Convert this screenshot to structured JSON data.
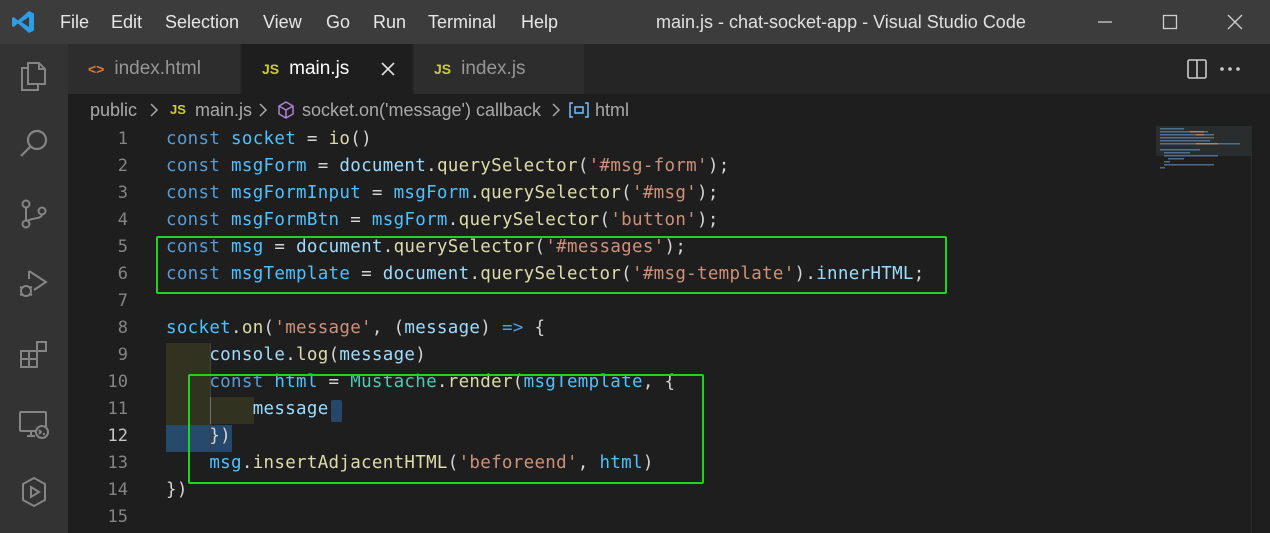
{
  "menu": {
    "items": [
      "File",
      "Edit",
      "Selection",
      "View",
      "Go",
      "Run",
      "Terminal",
      "Help"
    ]
  },
  "window": {
    "title": "main.js - chat-socket-app - Visual Studio Code"
  },
  "activity_bar": {
    "icons": [
      "explorer-icon",
      "search-icon",
      "source-control-icon",
      "run-debug-icon",
      "extensions-icon",
      "remote-explorer-icon",
      "live-share-icon"
    ]
  },
  "tabs": [
    {
      "label": "index.html",
      "badge": "<>",
      "active": false
    },
    {
      "label": "main.js",
      "badge": "JS",
      "active": true
    },
    {
      "label": "index.js",
      "badge": "JS",
      "active": false
    }
  ],
  "breadcrumb": {
    "folder": "public",
    "file_badge": "JS",
    "file": "main.js",
    "callback": "socket.on('message') callback",
    "symbol": "html"
  },
  "editor": {
    "line_numbers": [
      "1",
      "2",
      "3",
      "4",
      "5",
      "6",
      "7",
      "8",
      "9",
      "10",
      "11",
      "12",
      "13",
      "14",
      "15"
    ],
    "current_line": "12",
    "lines": [
      [
        [
          "kw",
          "const"
        ],
        [
          "pun",
          " "
        ],
        [
          "var",
          "socket"
        ],
        [
          "pun",
          " = "
        ],
        [
          "fn",
          "io"
        ],
        [
          "pun",
          "()"
        ]
      ],
      [
        [
          "kw",
          "const"
        ],
        [
          "pun",
          " "
        ],
        [
          "var",
          "msgForm"
        ],
        [
          "pun",
          " = "
        ],
        [
          "id",
          "document"
        ],
        [
          "pun",
          "."
        ],
        [
          "fn",
          "querySelector"
        ],
        [
          "pun",
          "("
        ],
        [
          "str",
          "'#msg-form'"
        ],
        [
          "pun",
          ");"
        ]
      ],
      [
        [
          "kw",
          "const"
        ],
        [
          "pun",
          " "
        ],
        [
          "var",
          "msgFormInput"
        ],
        [
          "pun",
          " = "
        ],
        [
          "var",
          "msgForm"
        ],
        [
          "pun",
          "."
        ],
        [
          "fn",
          "querySelector"
        ],
        [
          "pun",
          "("
        ],
        [
          "str",
          "'#msg'"
        ],
        [
          "pun",
          ");"
        ]
      ],
      [
        [
          "kw",
          "const"
        ],
        [
          "pun",
          " "
        ],
        [
          "var",
          "msgFormBtn"
        ],
        [
          "pun",
          " = "
        ],
        [
          "var",
          "msgForm"
        ],
        [
          "pun",
          "."
        ],
        [
          "fn",
          "querySelector"
        ],
        [
          "pun",
          "("
        ],
        [
          "str",
          "'button'"
        ],
        [
          "pun",
          ");"
        ]
      ],
      [
        [
          "kw",
          "const"
        ],
        [
          "pun",
          " "
        ],
        [
          "var",
          "msg"
        ],
        [
          "pun",
          " = "
        ],
        [
          "id",
          "document"
        ],
        [
          "pun",
          "."
        ],
        [
          "fn",
          "querySelector"
        ],
        [
          "pun",
          "("
        ],
        [
          "str",
          "'#messages'"
        ],
        [
          "pun",
          ");"
        ]
      ],
      [
        [
          "kw",
          "const"
        ],
        [
          "pun",
          " "
        ],
        [
          "var",
          "msgTemplate"
        ],
        [
          "pun",
          " = "
        ],
        [
          "id",
          "document"
        ],
        [
          "pun",
          "."
        ],
        [
          "fn",
          "querySelector"
        ],
        [
          "pun",
          "("
        ],
        [
          "str",
          "'#msg-template'"
        ],
        [
          "pun",
          ")."
        ],
        [
          "id",
          "innerHTML"
        ],
        [
          "pun",
          ";"
        ]
      ],
      [],
      [
        [
          "var",
          "socket"
        ],
        [
          "pun",
          "."
        ],
        [
          "fn",
          "on"
        ],
        [
          "pun",
          "("
        ],
        [
          "str",
          "'message'"
        ],
        [
          "pun",
          ", ("
        ],
        [
          "id",
          "message"
        ],
        [
          "pun",
          ") "
        ],
        [
          "kw",
          "=>"
        ],
        [
          "pun",
          " {"
        ]
      ],
      [
        [
          "pun",
          "    "
        ],
        [
          "id",
          "console"
        ],
        [
          "pun",
          "."
        ],
        [
          "fn",
          "log"
        ],
        [
          "pun",
          "("
        ],
        [
          "id",
          "message"
        ],
        [
          "pun",
          ")"
        ]
      ],
      [
        [
          "pun",
          "    "
        ],
        [
          "kw",
          "const"
        ],
        [
          "pun",
          " "
        ],
        [
          "var",
          "html"
        ],
        [
          "pun",
          " = "
        ],
        [
          "cls",
          "Mustache"
        ],
        [
          "pun",
          "."
        ],
        [
          "fn",
          "render"
        ],
        [
          "pun",
          "("
        ],
        [
          "var",
          "msgTemplate"
        ],
        [
          "pun",
          ", {"
        ]
      ],
      [
        [
          "pun",
          "        "
        ],
        [
          "id",
          "message"
        ]
      ],
      [
        [
          "pun",
          "    })"
        ]
      ],
      [
        [
          "pun",
          "    "
        ],
        [
          "var",
          "msg"
        ],
        [
          "pun",
          "."
        ],
        [
          "fn",
          "insertAdjacentHTML"
        ],
        [
          "pun",
          "("
        ],
        [
          "str",
          "'beforeend'"
        ],
        [
          "pun",
          ", "
        ],
        [
          "var",
          "html"
        ],
        [
          "pun",
          ")"
        ]
      ],
      [
        [
          "pun",
          "})"
        ]
      ],
      []
    ]
  },
  "colors": {
    "highlight_box": "#1ed41e",
    "selection": "#264f78",
    "accent_title": "#3c3c3c",
    "js_badge": "#cbcb41",
    "html_badge": "#e37933"
  }
}
